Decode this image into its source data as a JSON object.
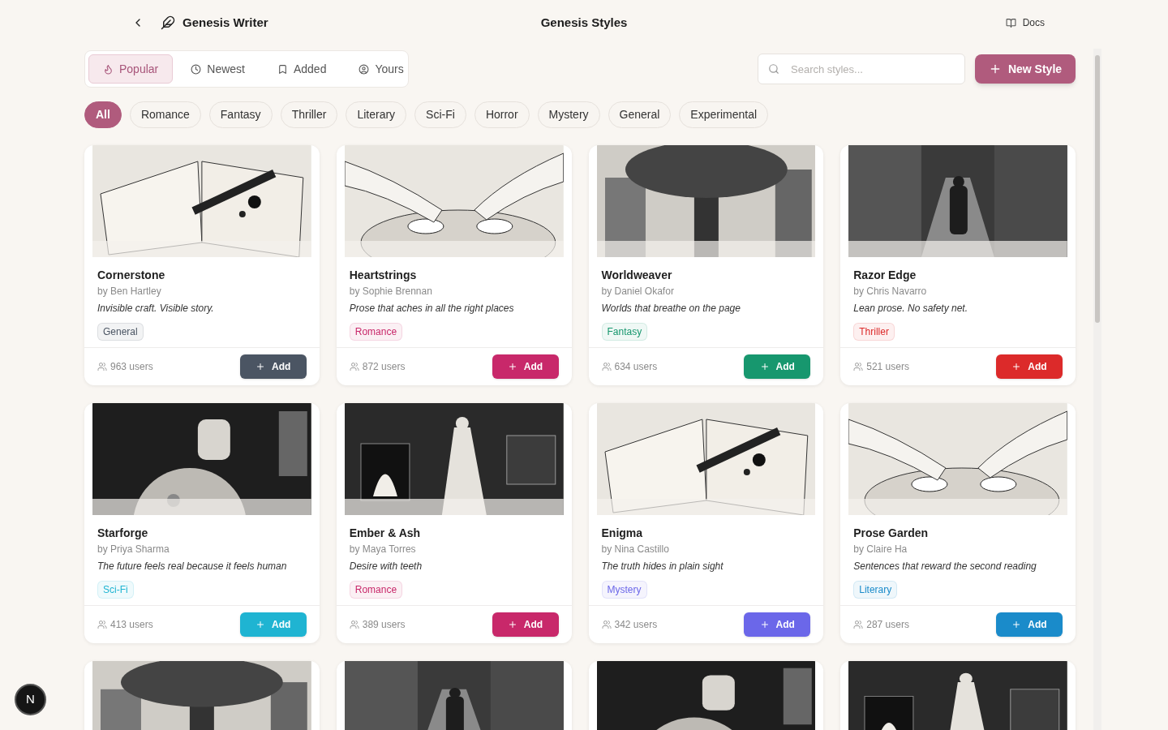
{
  "header": {
    "app_name": "Genesis Writer",
    "title": "Genesis Styles",
    "docs_link": "Docs"
  },
  "sort_tabs": [
    {
      "label": "Popular",
      "selected": true
    },
    {
      "label": "Newest",
      "selected": false
    },
    {
      "label": "Added",
      "selected": false
    },
    {
      "label": "Yours",
      "selected": false
    }
  ],
  "search": {
    "placeholder": "Search styles..."
  },
  "new_button": "New Style",
  "genres": [
    {
      "label": "All",
      "selected": true
    },
    {
      "label": "Romance",
      "selected": false
    },
    {
      "label": "Fantasy",
      "selected": false
    },
    {
      "label": "Thriller",
      "selected": false
    },
    {
      "label": "Literary",
      "selected": false
    },
    {
      "label": "Sci-Fi",
      "selected": false
    },
    {
      "label": "Horror",
      "selected": false
    },
    {
      "label": "Mystery",
      "selected": false
    },
    {
      "label": "General",
      "selected": false
    },
    {
      "label": "Experimental",
      "selected": false
    }
  ],
  "cards": [
    {
      "kind": "full",
      "title": "Cornerstone",
      "author": "by Ben Hartley",
      "tagline": "Invisible craft. Visible story.",
      "tag": "General",
      "color": "#4b5563",
      "users": "963 users",
      "button": "Add"
    },
    {
      "kind": "full",
      "title": "Heartstrings",
      "author": "by Sophie Brennan",
      "tagline": "Prose that aches in all the right places",
      "tag": "Romance",
      "color": "#c8286a",
      "users": "872 users",
      "button": "Add"
    },
    {
      "kind": "full",
      "title": "Worldweaver",
      "author": "by Daniel Okafor",
      "tagline": "Worlds that breathe on the page",
      "tag": "Fantasy",
      "color": "#17976e",
      "users": "634 users",
      "button": "Add"
    },
    {
      "kind": "full",
      "title": "Razor Edge",
      "author": "by Chris Navarro",
      "tagline": "Lean prose. No safety net.",
      "tag": "Thriller",
      "color": "#dc2a2a",
      "users": "521 users",
      "button": "Add"
    },
    {
      "kind": "full",
      "title": "Starforge",
      "author": "by Priya Sharma",
      "tagline": "The future feels real because it feels human",
      "tag": "Sci-Fi",
      "color": "#1fb4d2",
      "users": "413 users",
      "button": "Add"
    },
    {
      "kind": "full",
      "title": "Ember & Ash",
      "author": "by Maya Torres",
      "tagline": "Desire with teeth",
      "tag": "Romance",
      "color": "#c8286a",
      "users": "389 users",
      "button": "Add"
    },
    {
      "kind": "full",
      "title": "Enigma",
      "author": "by Nina Castillo",
      "tagline": "The truth hides in plain sight",
      "tag": "Mystery",
      "color": "#6b67e9",
      "users": "342 users",
      "button": "Add"
    },
    {
      "kind": "full",
      "title": "Prose Garden",
      "author": "by Claire Ha",
      "tagline": "Sentences that reward the second reading",
      "tag": "Literary",
      "color": "#1a8bca",
      "users": "287 users",
      "button": "Add"
    },
    {
      "kind": "partial"
    },
    {
      "kind": "partial"
    },
    {
      "kind": "partial"
    },
    {
      "kind": "partial"
    }
  ],
  "dev_badge": "N"
}
